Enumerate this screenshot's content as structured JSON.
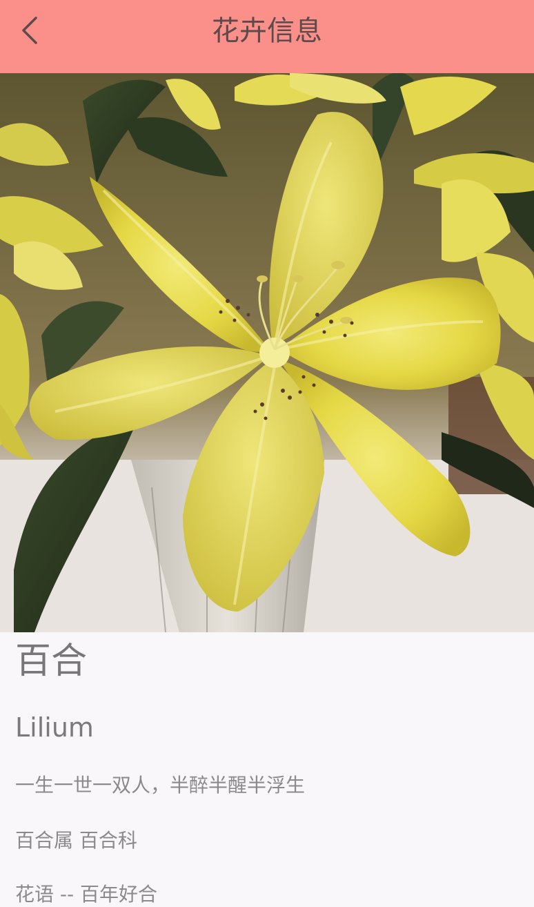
{
  "header": {
    "title": "花卉信息",
    "back_icon": "chevron-left-icon"
  },
  "colors": {
    "header_bg": "#fb908a",
    "page_bg": "#f9f7fa"
  },
  "flower": {
    "name": "百合",
    "latin": "Lilium",
    "motto": "一生一世一双人，半醉半醒半浮生",
    "taxonomy": "百合属 百合科",
    "language_label": "花语 -- 百年好合"
  }
}
